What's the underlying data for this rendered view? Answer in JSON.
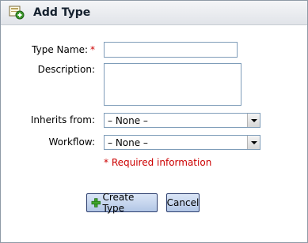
{
  "dialog": {
    "title": "Add Type",
    "title_icon": "add-type-icon"
  },
  "form": {
    "type_name_label": "Type Name:",
    "required_marker": "*",
    "type_name_value": "",
    "description_label": "Description:",
    "description_value": "",
    "inherits_label": "Inherits from:",
    "inherits_selected": "– None –",
    "workflow_label": "Workflow:",
    "workflow_selected": "– None –",
    "required_info": "* Required information"
  },
  "buttons": {
    "create_label": "Create Type",
    "create_icon": "plus-icon",
    "cancel_label": "Cancel"
  },
  "colors": {
    "required": "#cc0000",
    "button_border": "#2b3d6d",
    "field_border": "#7f9db9"
  }
}
